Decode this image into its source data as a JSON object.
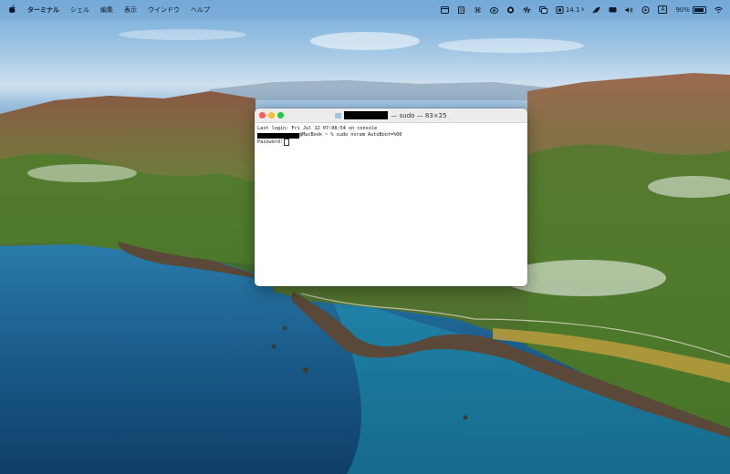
{
  "menubar": {
    "app_name": "ターミナル",
    "menus": [
      "シェル",
      "編集",
      "表示",
      "ウインドウ",
      "ヘルプ"
    ],
    "status_value": "14.1",
    "status_unit": "k",
    "keyboard_indicator": "A",
    "battery_percent": "90%",
    "battery_level": 0.9
  },
  "window": {
    "title_suffix": "— sudo — 83×25",
    "lines": {
      "login": "Last login: Fri Jul 12 07:08:54 on console",
      "command": "@MacBook ~ % sudo nvram AutoBoot=%00",
      "password": "Password:"
    }
  },
  "colors": {
    "close": "#fe5f57",
    "minimize": "#febc2e",
    "zoom": "#28c840"
  },
  "icons": {
    "apple": "apple-logo-icon",
    "menubar_right": [
      "calendar-icon",
      "clipboard-icon",
      "command-icon",
      "creative-cloud-icon",
      "status-c-icon",
      "sound-wave-icon",
      "screen-mirroring-icon",
      "cpu-chip-icon",
      "rocket-icon",
      "display-icon",
      "volume-icon",
      "play-icon",
      "keyboard-input-icon",
      "battery-icon",
      "wifi-icon"
    ]
  }
}
